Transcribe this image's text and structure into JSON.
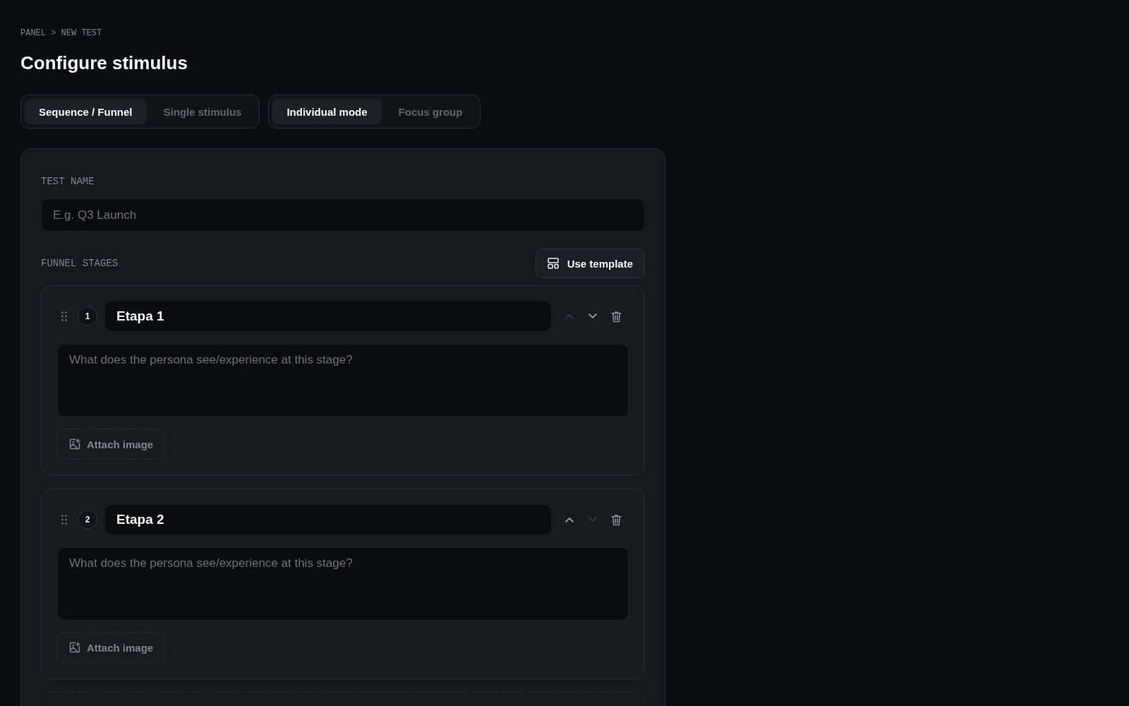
{
  "breadcrumb": "PANEL > NEW TEST",
  "title": "Configure stimulus",
  "segments": [
    {
      "options": [
        {
          "label": "Sequence / Funnel",
          "selected": true
        },
        {
          "label": "Single stimulus",
          "selected": false
        }
      ]
    },
    {
      "options": [
        {
          "label": "Individual mode",
          "selected": true
        },
        {
          "label": "Focus group",
          "selected": false
        }
      ]
    }
  ],
  "form": {
    "test_name": {
      "label": "TEST NAME",
      "placeholder": "E.g. Q3 Launch"
    },
    "stages_label": "FUNNEL STAGES",
    "template_button": "Use template",
    "stages": [
      {
        "number": "1",
        "name": "Etapa 1",
        "description_placeholder": "What does the persona see/experience at this stage?",
        "attach_label": "Attach image",
        "up_disabled": true,
        "down_disabled": false
      },
      {
        "number": "2",
        "name": "Etapa 2",
        "description_placeholder": "What does the persona see/experience at this stage?",
        "attach_label": "Attach image",
        "up_disabled": false,
        "down_disabled": true
      }
    ]
  }
}
